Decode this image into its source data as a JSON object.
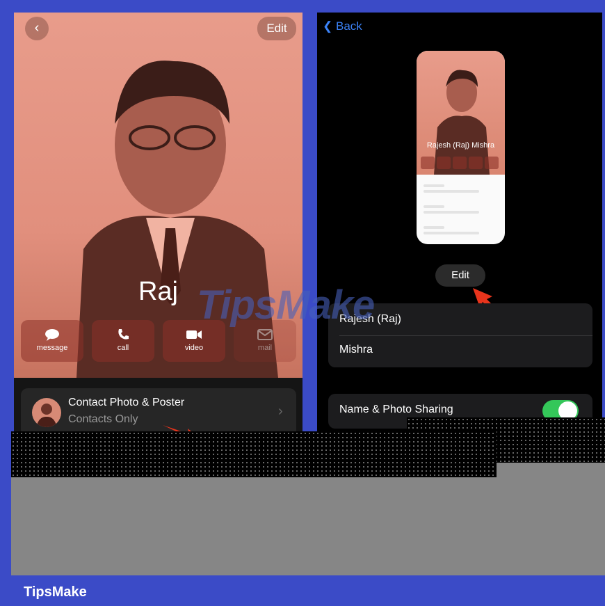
{
  "left_screen": {
    "back_icon": "chevron-left-icon",
    "edit_label": "Edit",
    "contact_name": "Raj",
    "actions": [
      {
        "label": "message",
        "icon": "message-bubble-icon"
      },
      {
        "label": "call",
        "icon": "phone-icon"
      },
      {
        "label": "video",
        "icon": "video-camera-icon"
      },
      {
        "label": "mail",
        "icon": "envelope-icon"
      }
    ],
    "contact_photo_card": {
      "title": "Contact Photo & Poster",
      "subtitle": "Contacts Only"
    }
  },
  "right_screen": {
    "back_label": "Back",
    "poster_preview_name": "Rajesh (Raj) Mishra",
    "edit_label": "Edit",
    "first_name": "Rajesh (Raj)",
    "last_name": "Mishra",
    "name_photo_sharing_label": "Name & Photo Sharing",
    "name_photo_sharing_on": true
  },
  "watermark": "TipsMake",
  "footer_brand": "TipsMake",
  "colors": {
    "frame": "#3b4bc7",
    "poster": "#e89c8b",
    "toggle_on": "#34c759",
    "link_blue": "#3b82f6",
    "arrow_red": "#e8341c"
  }
}
